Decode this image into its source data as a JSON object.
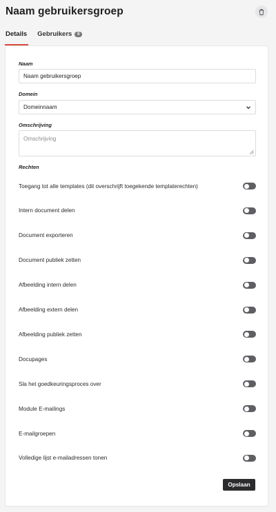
{
  "header": {
    "title": "Naam gebruikersgroep",
    "delete_icon": "trash-icon"
  },
  "tabs": [
    {
      "label": "Details",
      "active": true
    },
    {
      "label": "Gebruikers",
      "badge": "0",
      "active": false
    }
  ],
  "form": {
    "name": {
      "label": "Naam",
      "value": "Naam gebruikersgroep"
    },
    "domain": {
      "label": "Domein",
      "value": "Domeinnaam"
    },
    "description": {
      "label": "Omschrijving",
      "placeholder": "Omschrijving"
    },
    "rights_label": "Rechten",
    "permissions": [
      {
        "label": "Toegang tot alle templates (dit overschrijft toegekende templaterechten)",
        "enabled": false
      },
      {
        "label": "Intern document delen",
        "enabled": false
      },
      {
        "label": "Document exporteren",
        "enabled": false
      },
      {
        "label": "Document publiek zetten",
        "enabled": false
      },
      {
        "label": "Afbeelding intern delen",
        "enabled": false
      },
      {
        "label": "Afbeelding extern delen",
        "enabled": false
      },
      {
        "label": "Afbeelding publiek zetten",
        "enabled": false
      },
      {
        "label": "Docupages",
        "enabled": false
      },
      {
        "label": "Sla het goedkeuringsproces over",
        "enabled": false
      },
      {
        "label": "Module E-mailings",
        "enabled": false
      },
      {
        "label": "E-mailgroepen",
        "enabled": false
      },
      {
        "label": "Volledige lijst e-mailadressen tonen",
        "enabled": false
      }
    ],
    "save_label": "Opslaan"
  },
  "colors": {
    "accent": "#d9473b",
    "toggle_off": "#5f5f63",
    "button_bg": "#2b2b2d"
  }
}
